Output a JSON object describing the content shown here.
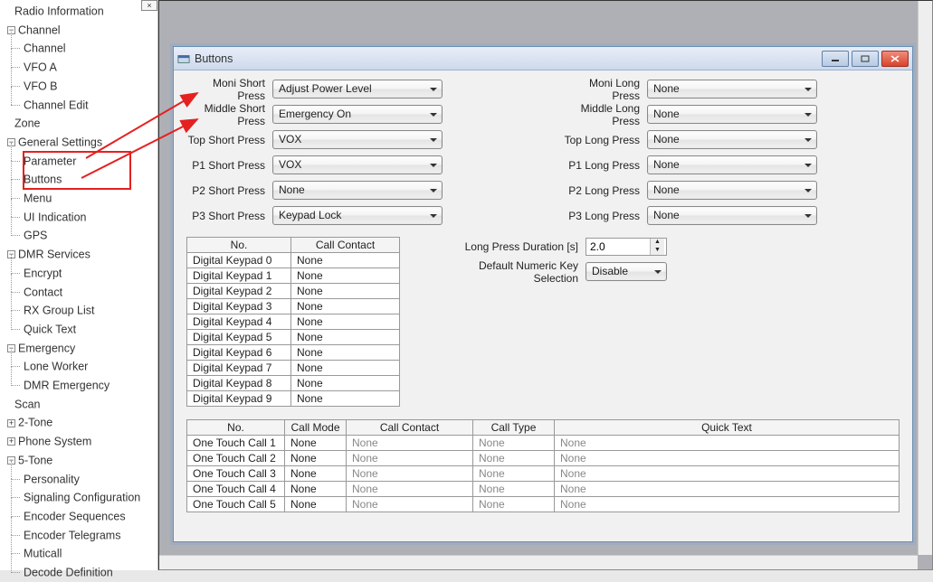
{
  "tree": {
    "radio_info": "Radio Information",
    "channel": "Channel",
    "channel_sub": "Channel",
    "vfo_a": "VFO A",
    "vfo_b": "VFO B",
    "channel_edit": "Channel Edit",
    "zone": "Zone",
    "general": "General Settings",
    "parameter": "Parameter",
    "buttons": "Buttons",
    "menu": "Menu",
    "ui_ind": "UI Indication",
    "gps": "GPS",
    "dmr": "DMR Services",
    "encrypt": "Encrypt",
    "contact": "Contact",
    "rx_group": "RX Group List",
    "quick_text": "Quick Text",
    "emergency": "Emergency",
    "lone_worker": "Lone Worker",
    "dmr_emergency": "DMR Emergency",
    "scan": "Scan",
    "two_tone": "2-Tone",
    "phone_sys": "Phone System",
    "five_tone": "5-Tone",
    "personality": "Personality",
    "sig_config": "Signaling Configuration",
    "enc_seq": "Encoder Sequences",
    "enc_tel": "Encoder Telegrams",
    "muticall": "Muticall",
    "decode_def": "Decode Definition"
  },
  "window": {
    "title": "Buttons"
  },
  "labels": {
    "moni_sp": "Moni Short Press",
    "middle_sp": "Middle Short Press",
    "top_sp": "Top Short Press",
    "p1_sp": "P1 Short Press",
    "p2_sp": "P2 Short Press",
    "p3_sp": "P3 Short Press",
    "moni_lp": "Moni Long Press",
    "middle_lp": "Middle Long Press",
    "top_lp": "Top Long Press",
    "p1_lp": "P1 Long Press",
    "p2_lp": "P2 Long Press",
    "p3_lp": "P3 Long Press",
    "lp_dur": "Long Press Duration [s]",
    "def_numkey": "Default Numeric Key Selection"
  },
  "values": {
    "moni_sp": "Adjust Power Level",
    "middle_sp": "Emergency On",
    "top_sp": "VOX",
    "p1_sp": "VOX",
    "p2_sp": "None",
    "p3_sp": "Keypad Lock",
    "moni_lp": "None",
    "middle_lp": "None",
    "top_lp": "None",
    "p1_lp": "None",
    "p2_lp": "None",
    "p3_lp": "None",
    "lp_dur": "2.0",
    "def_numkey": "Disable"
  },
  "keypad_table": {
    "headers": [
      "No.",
      "Call Contact"
    ],
    "rows": [
      {
        "no": "Digital Keypad 0",
        "contact": "None"
      },
      {
        "no": "Digital Keypad 1",
        "contact": "None"
      },
      {
        "no": "Digital Keypad 2",
        "contact": "None"
      },
      {
        "no": "Digital Keypad 3",
        "contact": "None"
      },
      {
        "no": "Digital Keypad 4",
        "contact": "None"
      },
      {
        "no": "Digital Keypad 5",
        "contact": "None"
      },
      {
        "no": "Digital Keypad 6",
        "contact": "None"
      },
      {
        "no": "Digital Keypad 7",
        "contact": "None"
      },
      {
        "no": "Digital Keypad 8",
        "contact": "None"
      },
      {
        "no": "Digital Keypad 9",
        "contact": "None"
      }
    ]
  },
  "touch_table": {
    "headers": [
      "No.",
      "Call Mode",
      "Call Contact",
      "Call Type",
      "Quick Text"
    ],
    "rows": [
      {
        "no": "One Touch Call 1",
        "mode": "None",
        "contact": "None",
        "type": "None",
        "qt": "None"
      },
      {
        "no": "One Touch Call 2",
        "mode": "None",
        "contact": "None",
        "type": "None",
        "qt": "None"
      },
      {
        "no": "One Touch Call 3",
        "mode": "None",
        "contact": "None",
        "type": "None",
        "qt": "None"
      },
      {
        "no": "One Touch Call 4",
        "mode": "None",
        "contact": "None",
        "type": "None",
        "qt": "None"
      },
      {
        "no": "One Touch Call 5",
        "mode": "None",
        "contact": "None",
        "type": "None",
        "qt": "None"
      }
    ]
  }
}
